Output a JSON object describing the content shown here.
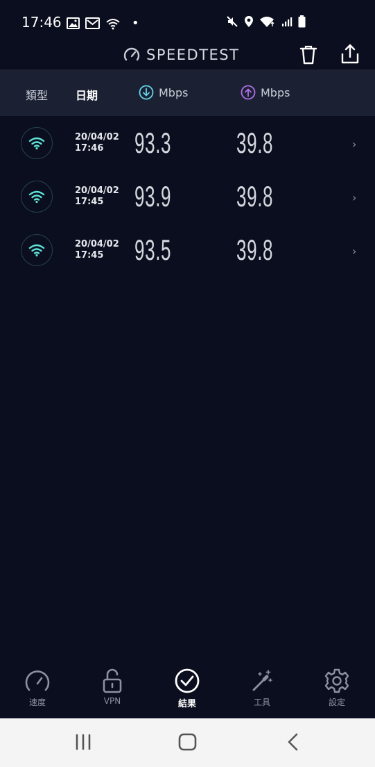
{
  "status_bar": {
    "time": "17:46",
    "dot": "•",
    "left_icons": [
      "image-icon",
      "mail-icon",
      "wifi-call-icon"
    ],
    "right_icons": [
      "mute-icon",
      "location-icon",
      "wifi-icon",
      "signal-icon",
      "battery-icon"
    ]
  },
  "app_bar": {
    "title": "SPEEDTEST",
    "icons": [
      "speedometer-icon",
      "trash-icon",
      "share-icon"
    ]
  },
  "header": {
    "type": "類型",
    "date": "日期",
    "download_unit": "Mbps",
    "upload_unit": "Mbps"
  },
  "results": [
    {
      "date": "20/04/02",
      "time": "17:46",
      "download": "93.3",
      "upload": "39.8"
    },
    {
      "date": "20/04/02",
      "time": "17:45",
      "download": "93.9",
      "upload": "39.8"
    },
    {
      "date": "20/04/02",
      "time": "17:45",
      "download": "93.5",
      "upload": "39.8"
    }
  ],
  "chevron": "›",
  "bottom_nav": [
    {
      "label": "速度",
      "icon": "speedometer-icon"
    },
    {
      "label": "VPN",
      "icon": "lock-icon"
    },
    {
      "label": "結果",
      "icon": "check-circle-icon",
      "active": true
    },
    {
      "label": "工具",
      "icon": "magic-wand-icon"
    },
    {
      "label": "設定",
      "icon": "gear-icon"
    }
  ],
  "colors": {
    "background": "#0b0e1e",
    "header_bg": "#1b2033",
    "download_accent": "#62d6e8",
    "upload_accent": "#b06fe6",
    "wifi_accent": "#5fe3d9"
  }
}
